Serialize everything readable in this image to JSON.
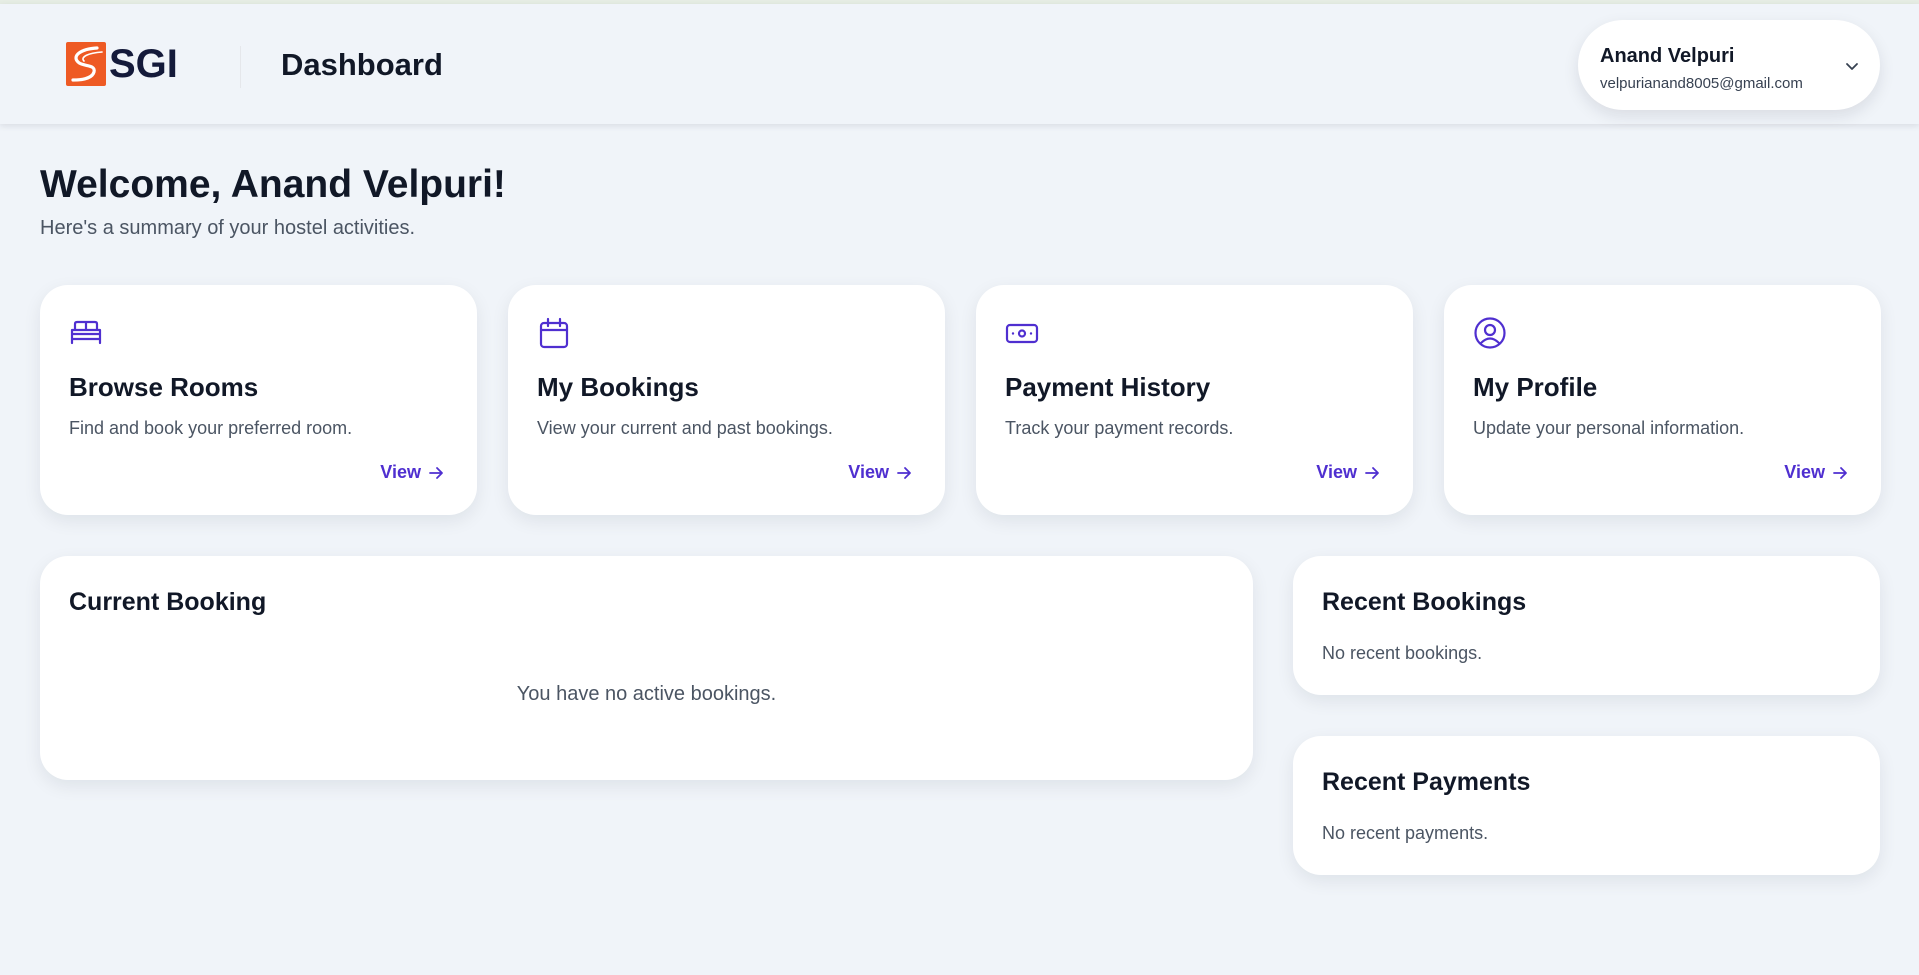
{
  "header": {
    "logo_text": "SGI",
    "page_title": "Dashboard",
    "user": {
      "name": "Anand Velpuri",
      "email": "velpurianand8005@gmail.com"
    }
  },
  "welcome": {
    "title": "Welcome, Anand Velpuri!",
    "subtitle": "Here's a summary of your hostel activities."
  },
  "quick_links": [
    {
      "icon": "bed-icon",
      "title": "Browse Rooms",
      "description": "Find and book your preferred room.",
      "link": "View"
    },
    {
      "icon": "calendar-icon",
      "title": "My Bookings",
      "description": "View your current and past bookings.",
      "link": "View"
    },
    {
      "icon": "banknote-icon",
      "title": "Payment History",
      "description": "Track your payment records.",
      "link": "View"
    },
    {
      "icon": "user-circle-icon",
      "title": "My Profile",
      "description": "Update your personal information.",
      "link": "View"
    }
  ],
  "current_booking": {
    "title": "Current Booking",
    "empty_text": "You have no active bookings."
  },
  "recent_bookings": {
    "title": "Recent Bookings",
    "empty_text": "No recent bookings."
  },
  "recent_payments": {
    "title": "Recent Payments",
    "empty_text": "No recent payments."
  },
  "colors": {
    "accent": "#4f2fd0",
    "logo": "#ee5a24",
    "background": "#f0f4f9"
  }
}
